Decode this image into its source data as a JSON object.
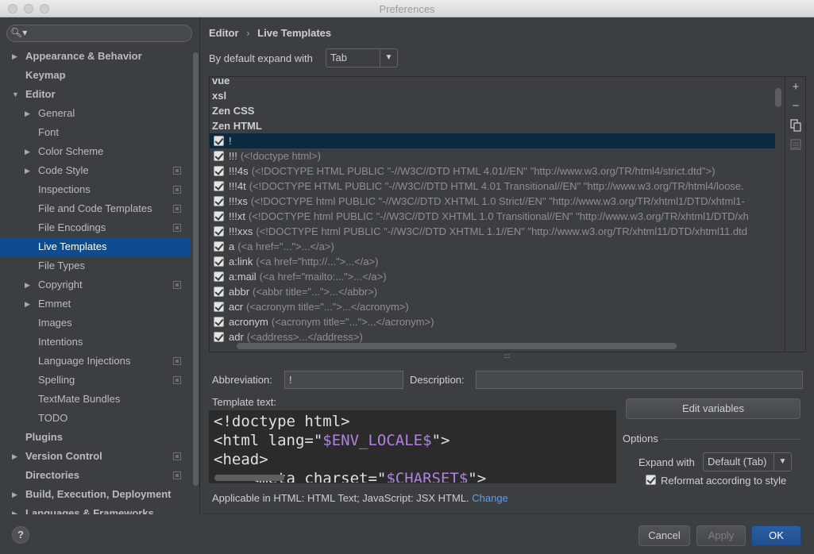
{
  "window": {
    "title": "Preferences"
  },
  "sidebar": {
    "search_placeholder": "",
    "items": [
      {
        "label": "Appearance & Behavior",
        "level": 0,
        "arrow": "right",
        "bold": true
      },
      {
        "label": "Keymap",
        "level": 0,
        "bold": true
      },
      {
        "label": "Editor",
        "level": 0,
        "arrow": "down",
        "bold": true
      },
      {
        "label": "General",
        "level": 1,
        "arrow": "right"
      },
      {
        "label": "Font",
        "level": 1
      },
      {
        "label": "Color Scheme",
        "level": 1,
        "arrow": "right"
      },
      {
        "label": "Code Style",
        "level": 1,
        "arrow": "right",
        "project": true
      },
      {
        "label": "Inspections",
        "level": 1,
        "project": true
      },
      {
        "label": "File and Code Templates",
        "level": 1,
        "project": true
      },
      {
        "label": "File Encodings",
        "level": 1,
        "project": true
      },
      {
        "label": "Live Templates",
        "level": 1,
        "selected": true
      },
      {
        "label": "File Types",
        "level": 1
      },
      {
        "label": "Copyright",
        "level": 1,
        "arrow": "right",
        "project": true
      },
      {
        "label": "Emmet",
        "level": 1,
        "arrow": "right"
      },
      {
        "label": "Images",
        "level": 1
      },
      {
        "label": "Intentions",
        "level": 1
      },
      {
        "label": "Language Injections",
        "level": 1,
        "project": true
      },
      {
        "label": "Spelling",
        "level": 1,
        "project": true
      },
      {
        "label": "TextMate Bundles",
        "level": 1
      },
      {
        "label": "TODO",
        "level": 1
      },
      {
        "label": "Plugins",
        "level": 0,
        "bold": true
      },
      {
        "label": "Version Control",
        "level": 0,
        "arrow": "right",
        "bold": true,
        "project": true
      },
      {
        "label": "Directories",
        "level": 0,
        "bold": true,
        "project": true
      },
      {
        "label": "Build, Execution, Deployment",
        "level": 0,
        "arrow": "right",
        "bold": true
      },
      {
        "label": "Languages & Frameworks",
        "level": 0,
        "arrow": "right",
        "bold": true
      }
    ]
  },
  "breadcrumb": {
    "parent": "Editor",
    "separator": "›",
    "current": "Live Templates"
  },
  "expand": {
    "label": "By default expand with",
    "value": "Tab"
  },
  "templates": {
    "groups_top": [
      "vue",
      "xsl",
      "Zen CSS",
      "Zen HTML"
    ],
    "rows": [
      {
        "abbr": "!",
        "desc": "",
        "selected": true
      },
      {
        "abbr": "!!!",
        "desc": "(<!doctype html>)"
      },
      {
        "abbr": "!!!4s",
        "desc": "(<!DOCTYPE HTML PUBLIC \"-//W3C//DTD HTML 4.01//EN\" \"http://www.w3.org/TR/html4/strict.dtd\">)"
      },
      {
        "abbr": "!!!4t",
        "desc": "(<!DOCTYPE HTML PUBLIC \"-//W3C//DTD HTML 4.01 Transitional//EN\" \"http://www.w3.org/TR/html4/loose."
      },
      {
        "abbr": "!!!xs",
        "desc": "(<!DOCTYPE html PUBLIC \"-//W3C//DTD XHTML 1.0 Strict//EN\" \"http://www.w3.org/TR/xhtml1/DTD/xhtml1-"
      },
      {
        "abbr": "!!!xt",
        "desc": "(<!DOCTYPE html PUBLIC \"-//W3C//DTD XHTML 1.0 Transitional//EN\" \"http://www.w3.org/TR/xhtml1/DTD/xh"
      },
      {
        "abbr": "!!!xxs",
        "desc": "(<!DOCTYPE html PUBLIC \"-//W3C//DTD XHTML 1.1//EN\" \"http://www.w3.org/TR/xhtml11/DTD/xhtml11.dtd"
      },
      {
        "abbr": "a",
        "desc": "(<a href=\"...\">...</a>)"
      },
      {
        "abbr": "a:link",
        "desc": "(<a href=\"http://...\">...</a>)"
      },
      {
        "abbr": "a:mail",
        "desc": "(<a href=\"mailto:...\">...</a>)"
      },
      {
        "abbr": "abbr",
        "desc": "(<abbr title=\"...\">...</abbr>)"
      },
      {
        "abbr": "acr",
        "desc": "(<acronym title=\"...\">...</acronym>)"
      },
      {
        "abbr": "acronym",
        "desc": "(<acronym title=\"...\">...</acronym>)"
      },
      {
        "abbr": "adr",
        "desc": "(<address>...</address>)"
      }
    ]
  },
  "toolbar": {
    "add": "+",
    "remove": "−",
    "copy_icon": "copy-icon",
    "restore_icon": "list-icon"
  },
  "form": {
    "abbreviation_label": "Abbreviation:",
    "abbreviation_value": "!",
    "description_label": "Description:",
    "description_value": "",
    "template_text_label": "Template text:",
    "template_lines": [
      {
        "pre": "<!doctype html>",
        "var": "",
        "post": ""
      },
      {
        "pre": "<html lang=\"",
        "var": "$ENV_LOCALE$",
        "post": "\">"
      },
      {
        "pre": "<head>",
        "var": "",
        "post": ""
      },
      {
        "pre": "    <meta charset=\"",
        "var": "$CHARSET$",
        "post": "\">"
      }
    ],
    "edit_variables": "Edit variables",
    "options_title": "Options",
    "expand_with_label": "Expand with",
    "expand_with_value": "Default (Tab)",
    "reformat_label": "Reformat according to style",
    "applicable_text": "Applicable in HTML: HTML Text; JavaScript: JSX HTML.",
    "change_link": "Change"
  },
  "footer": {
    "help": "?",
    "cancel": "Cancel",
    "apply": "Apply",
    "ok": "OK"
  },
  "colors": {
    "selection": "#0d4c8f",
    "link": "#589df6",
    "template_var": "#b180e0",
    "background": "#3c3f41"
  }
}
